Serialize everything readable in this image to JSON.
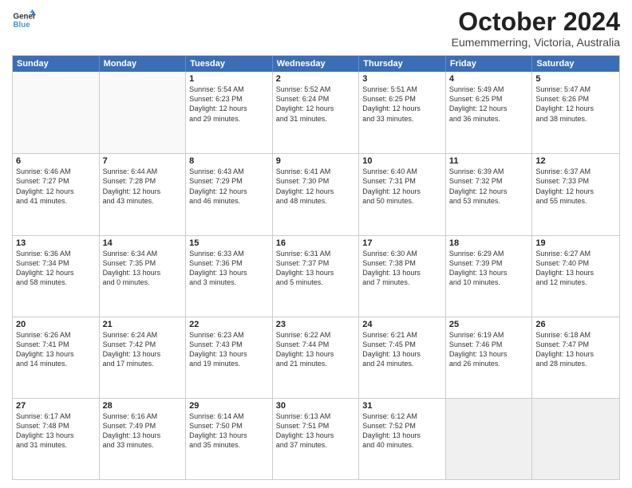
{
  "logo": {
    "line1": "General",
    "line2": "Blue"
  },
  "title": "October 2024",
  "subtitle": "Eumemmerring, Victoria, Australia",
  "header_days": [
    "Sunday",
    "Monday",
    "Tuesday",
    "Wednesday",
    "Thursday",
    "Friday",
    "Saturday"
  ],
  "weeks": [
    [
      {
        "day": "",
        "info": ""
      },
      {
        "day": "",
        "info": ""
      },
      {
        "day": "1",
        "info": "Sunrise: 5:54 AM\nSunset: 6:23 PM\nDaylight: 12 hours\nand 29 minutes."
      },
      {
        "day": "2",
        "info": "Sunrise: 5:52 AM\nSunset: 6:24 PM\nDaylight: 12 hours\nand 31 minutes."
      },
      {
        "day": "3",
        "info": "Sunrise: 5:51 AM\nSunset: 6:25 PM\nDaylight: 12 hours\nand 33 minutes."
      },
      {
        "day": "4",
        "info": "Sunrise: 5:49 AM\nSunset: 6:25 PM\nDaylight: 12 hours\nand 36 minutes."
      },
      {
        "day": "5",
        "info": "Sunrise: 5:47 AM\nSunset: 6:26 PM\nDaylight: 12 hours\nand 38 minutes."
      }
    ],
    [
      {
        "day": "6",
        "info": "Sunrise: 6:46 AM\nSunset: 7:27 PM\nDaylight: 12 hours\nand 41 minutes."
      },
      {
        "day": "7",
        "info": "Sunrise: 6:44 AM\nSunset: 7:28 PM\nDaylight: 12 hours\nand 43 minutes."
      },
      {
        "day": "8",
        "info": "Sunrise: 6:43 AM\nSunset: 7:29 PM\nDaylight: 12 hours\nand 46 minutes."
      },
      {
        "day": "9",
        "info": "Sunrise: 6:41 AM\nSunset: 7:30 PM\nDaylight: 12 hours\nand 48 minutes."
      },
      {
        "day": "10",
        "info": "Sunrise: 6:40 AM\nSunset: 7:31 PM\nDaylight: 12 hours\nand 50 minutes."
      },
      {
        "day": "11",
        "info": "Sunrise: 6:39 AM\nSunset: 7:32 PM\nDaylight: 12 hours\nand 53 minutes."
      },
      {
        "day": "12",
        "info": "Sunrise: 6:37 AM\nSunset: 7:33 PM\nDaylight: 12 hours\nand 55 minutes."
      }
    ],
    [
      {
        "day": "13",
        "info": "Sunrise: 6:36 AM\nSunset: 7:34 PM\nDaylight: 12 hours\nand 58 minutes."
      },
      {
        "day": "14",
        "info": "Sunrise: 6:34 AM\nSunset: 7:35 PM\nDaylight: 13 hours\nand 0 minutes."
      },
      {
        "day": "15",
        "info": "Sunrise: 6:33 AM\nSunset: 7:36 PM\nDaylight: 13 hours\nand 3 minutes."
      },
      {
        "day": "16",
        "info": "Sunrise: 6:31 AM\nSunset: 7:37 PM\nDaylight: 13 hours\nand 5 minutes."
      },
      {
        "day": "17",
        "info": "Sunrise: 6:30 AM\nSunset: 7:38 PM\nDaylight: 13 hours\nand 7 minutes."
      },
      {
        "day": "18",
        "info": "Sunrise: 6:29 AM\nSunset: 7:39 PM\nDaylight: 13 hours\nand 10 minutes."
      },
      {
        "day": "19",
        "info": "Sunrise: 6:27 AM\nSunset: 7:40 PM\nDaylight: 13 hours\nand 12 minutes."
      }
    ],
    [
      {
        "day": "20",
        "info": "Sunrise: 6:26 AM\nSunset: 7:41 PM\nDaylight: 13 hours\nand 14 minutes."
      },
      {
        "day": "21",
        "info": "Sunrise: 6:24 AM\nSunset: 7:42 PM\nDaylight: 13 hours\nand 17 minutes."
      },
      {
        "day": "22",
        "info": "Sunrise: 6:23 AM\nSunset: 7:43 PM\nDaylight: 13 hours\nand 19 minutes."
      },
      {
        "day": "23",
        "info": "Sunrise: 6:22 AM\nSunset: 7:44 PM\nDaylight: 13 hours\nand 21 minutes."
      },
      {
        "day": "24",
        "info": "Sunrise: 6:21 AM\nSunset: 7:45 PM\nDaylight: 13 hours\nand 24 minutes."
      },
      {
        "day": "25",
        "info": "Sunrise: 6:19 AM\nSunset: 7:46 PM\nDaylight: 13 hours\nand 26 minutes."
      },
      {
        "day": "26",
        "info": "Sunrise: 6:18 AM\nSunset: 7:47 PM\nDaylight: 13 hours\nand 28 minutes."
      }
    ],
    [
      {
        "day": "27",
        "info": "Sunrise: 6:17 AM\nSunset: 7:48 PM\nDaylight: 13 hours\nand 31 minutes."
      },
      {
        "day": "28",
        "info": "Sunrise: 6:16 AM\nSunset: 7:49 PM\nDaylight: 13 hours\nand 33 minutes."
      },
      {
        "day": "29",
        "info": "Sunrise: 6:14 AM\nSunset: 7:50 PM\nDaylight: 13 hours\nand 35 minutes."
      },
      {
        "day": "30",
        "info": "Sunrise: 6:13 AM\nSunset: 7:51 PM\nDaylight: 13 hours\nand 37 minutes."
      },
      {
        "day": "31",
        "info": "Sunrise: 6:12 AM\nSunset: 7:52 PM\nDaylight: 13 hours\nand 40 minutes."
      },
      {
        "day": "",
        "info": ""
      },
      {
        "day": "",
        "info": ""
      }
    ]
  ]
}
